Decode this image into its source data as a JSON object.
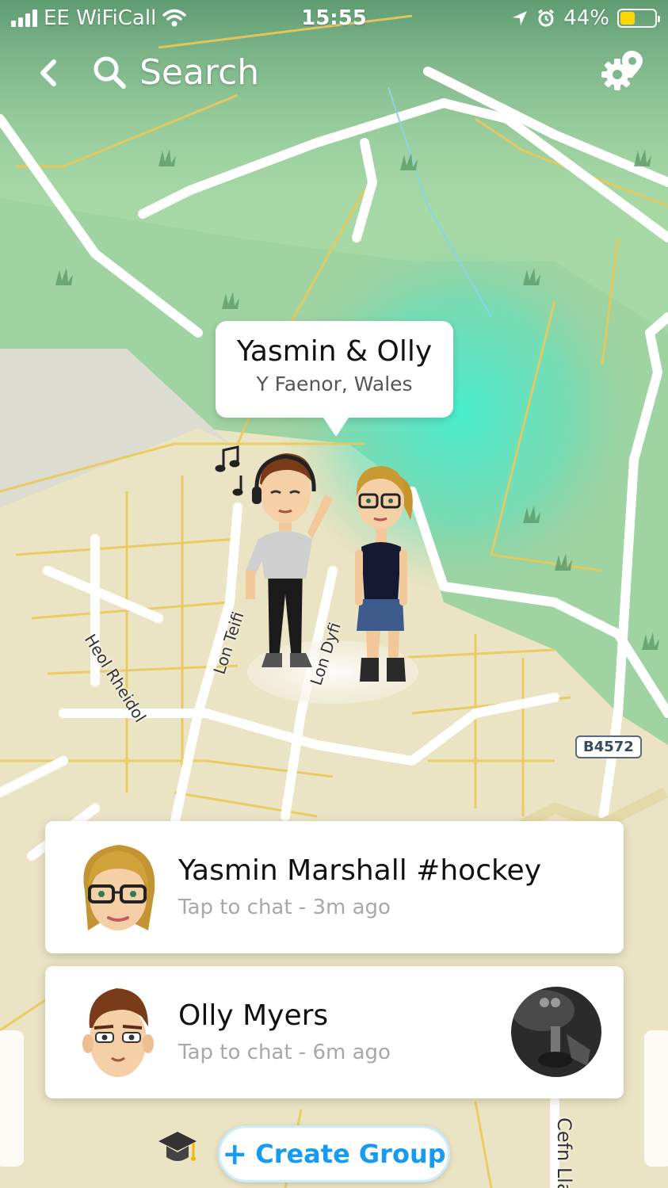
{
  "status_bar": {
    "carrier": "EE WiFiCall",
    "time": "15:55",
    "battery_percent": "44%",
    "battery_level": 0.44
  },
  "header": {
    "search_label": "Search"
  },
  "map": {
    "callout": {
      "title": "Yasmin & Olly",
      "subtitle": "Y Faenor, Wales"
    },
    "road_labels": [
      "Heol Rheidol",
      "Lon Teifi",
      "Lon Dyfi",
      "Cefn Lla"
    ],
    "road_number": "B4572"
  },
  "friends": [
    {
      "name": "Yasmin Marshall #hockey",
      "status": "Tap to chat - 3m ago"
    },
    {
      "name": "Olly Myers",
      "status": "Tap to chat - 6m ago"
    }
  ],
  "actions": {
    "create_group": "Create Group"
  },
  "colors": {
    "accent": "#169bf2",
    "heat": "#3de0c8",
    "battery": "#ffd400"
  }
}
